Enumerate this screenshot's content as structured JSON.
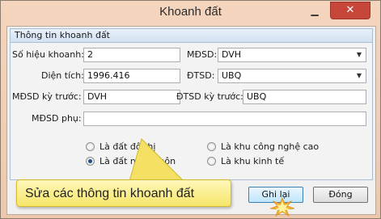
{
  "window": {
    "title": "Khoanh đất",
    "minimize_icon": "minimize-icon",
    "close_icon": "close-icon"
  },
  "group": {
    "header": "Thông tin khoanh đất"
  },
  "form": {
    "so_hieu_khoanh": {
      "label": "Số hiệu khoanh:",
      "value": "2"
    },
    "mdsd": {
      "label": "MĐSD:",
      "value": "DVH"
    },
    "dien_tich": {
      "label": "Diện tích:",
      "value": "1996.416"
    },
    "dtsd": {
      "label": "ĐTSD:",
      "value": "UBQ"
    },
    "mdsd_ky_truoc": {
      "label": "MĐSD kỳ trước:",
      "value": "DVH"
    },
    "dtsd_ky_truoc": {
      "label": "ĐTSD kỳ trước:",
      "value": "UBQ"
    },
    "mdsd_phu": {
      "label": "MĐSD phụ:",
      "value": ""
    }
  },
  "radios": {
    "do_thi": {
      "label": "Là đất đô thị",
      "checked": false
    },
    "nong_thon": {
      "label": "Là đất nông thôn",
      "checked": true
    },
    "cong_nghe_cao": {
      "label": "Là khu công nghệ cao",
      "checked": false
    },
    "kinh_te": {
      "label": "Là khu kinh tế",
      "checked": false
    }
  },
  "buttons": {
    "save": "Ghi lại",
    "close": "Đóng"
  },
  "callout": {
    "text": "Sửa các thông tin khoanh đất"
  },
  "colors": {
    "title_bar": "#eec8ad",
    "close_button": "#c7463a",
    "group_header": "#d2e1f1",
    "callout": "#f6e66a",
    "radio_selected": "#1b4f8a"
  }
}
